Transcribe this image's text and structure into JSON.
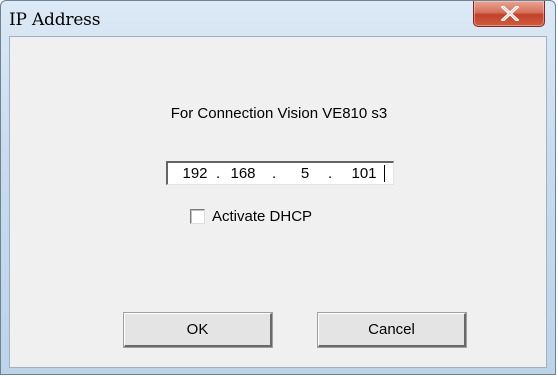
{
  "window": {
    "title": "IP Address"
  },
  "dialog": {
    "connection_text": "For Connection Vision VE810 s3",
    "ip_address": {
      "octet1": "192",
      "octet2": "168",
      "octet3": "5",
      "octet4": "101",
      "separator": "."
    },
    "dhcp": {
      "label": "Activate DHCP",
      "checked": false
    },
    "buttons": {
      "ok_label": "OK",
      "cancel_label": "Cancel"
    }
  },
  "icons": {
    "close": "close-icon"
  },
  "colors": {
    "close_button": "#c2412a",
    "client_background": "#f0f0f0",
    "frame": "#bcd3ea"
  }
}
